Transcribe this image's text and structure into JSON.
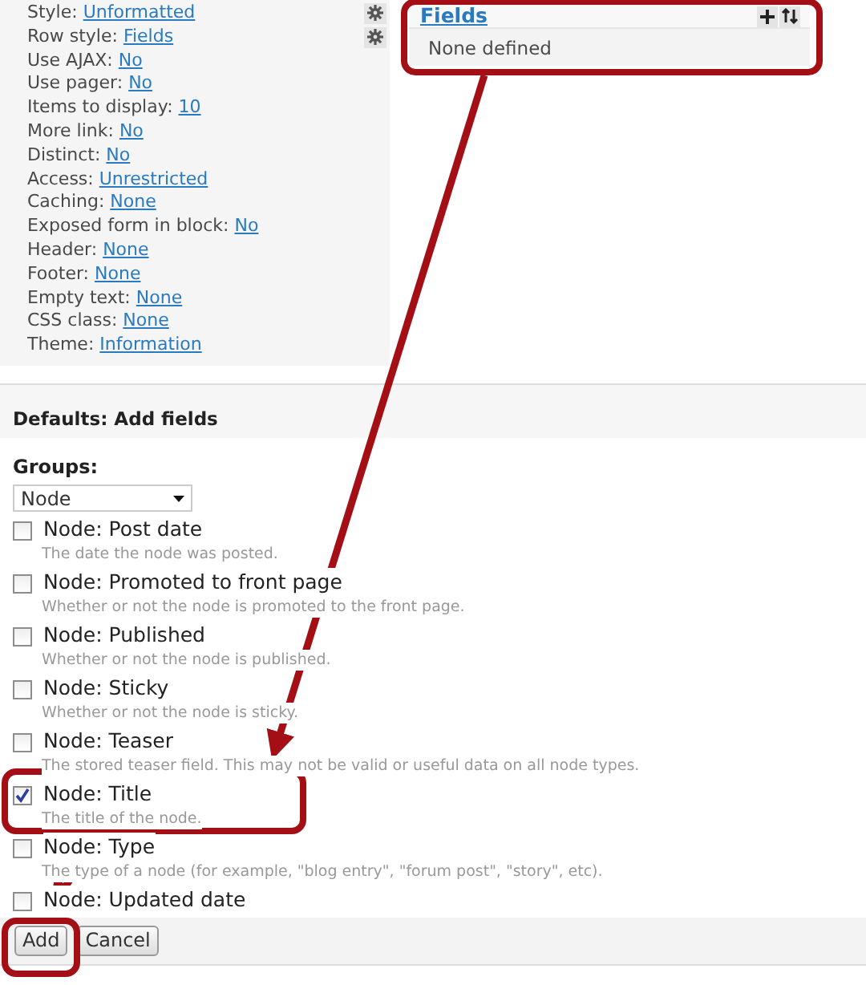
{
  "settings": [
    {
      "label": "Style:",
      "value": "Unformatted",
      "has_gear": true
    },
    {
      "label": "Row style:",
      "value": "Fields",
      "has_gear": true
    },
    {
      "label": "Use AJAX:",
      "value": "No",
      "has_gear": false
    },
    {
      "label": "Use pager:",
      "value": "No",
      "has_gear": false
    },
    {
      "label": "Items to display:",
      "value": "10",
      "has_gear": false
    },
    {
      "label": "More link:",
      "value": "No",
      "has_gear": false
    },
    {
      "label": "Distinct:",
      "value": "No",
      "has_gear": false
    },
    {
      "label": "Access:",
      "value": "Unrestricted",
      "has_gear": false
    },
    {
      "label": "Caching:",
      "value": "None",
      "has_gear": false
    },
    {
      "label": "Exposed form in block:",
      "value": "No",
      "has_gear": false
    },
    {
      "label": "Header:",
      "value": "None",
      "has_gear": false
    },
    {
      "label": "Footer:",
      "value": "None",
      "has_gear": false
    },
    {
      "label": "Empty text:",
      "value": "None",
      "has_gear": false
    },
    {
      "label": "CSS class:",
      "value": "None",
      "has_gear": false
    },
    {
      "label": "Theme:",
      "value": "Information",
      "has_gear": false
    }
  ],
  "fields_panel": {
    "title": "Fields",
    "empty_text": "None defined"
  },
  "add_fields": {
    "heading": "Defaults: Add fields",
    "groups_label": "Groups:",
    "groups_value": "Node",
    "items": [
      {
        "label": "Node: Post date",
        "description": "The date the node was posted.",
        "checked": false
      },
      {
        "label": "Node: Promoted to front page",
        "description": "Whether or not the node is promoted to the front page.",
        "checked": false
      },
      {
        "label": "Node: Published",
        "description": "Whether or not the node is published.",
        "checked": false
      },
      {
        "label": "Node: Sticky",
        "description": "Whether or not the node is sticky.",
        "checked": false
      },
      {
        "label": "Node: Teaser",
        "description": "The stored teaser field. This may not be valid or useful data on all node types.",
        "checked": false
      },
      {
        "label": "Node: Title",
        "description": "The title of the node.",
        "checked": true
      },
      {
        "label": "Node: Type",
        "description": "The type of a node (for example, \"blog entry\", \"forum post\", \"story\", etc).",
        "checked": false
      },
      {
        "label": "Node: Updated date",
        "checked": false
      }
    ]
  },
  "buttons": [
    "Add",
    "Cancel"
  ]
}
